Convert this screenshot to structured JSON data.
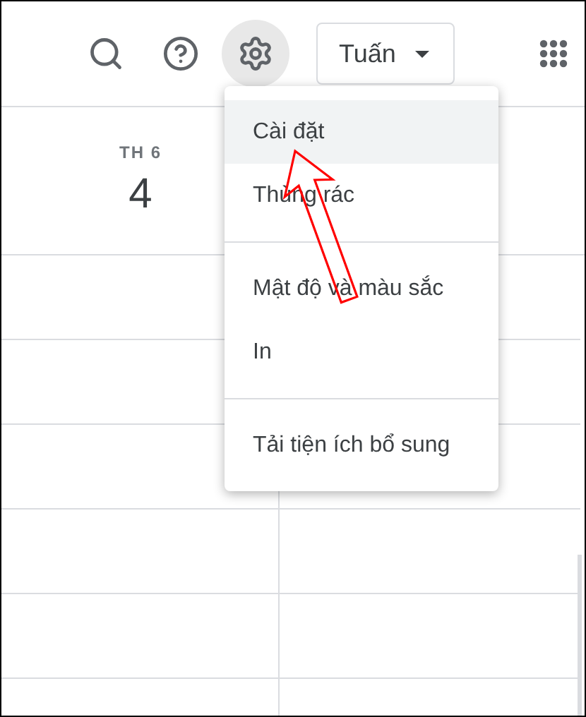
{
  "toolbar": [
    {
      "kind": "search",
      "selected": false
    },
    {
      "kind": "help",
      "selected": false
    },
    {
      "kind": "settings",
      "selected": true
    }
  ],
  "view_button": {
    "label": "Tuấn"
  },
  "day": {
    "weekday": "TH 6",
    "date": "4"
  },
  "menu": {
    "groups": [
      [
        {
          "label": "Cài đặt",
          "selected": true
        },
        {
          "label": "Thùng rác",
          "selected": false
        }
      ],
      [
        {
          "label": "Mật độ và màu sắc",
          "selected": false
        },
        {
          "label": "In",
          "selected": false
        }
      ],
      [
        {
          "label": "Tải tiện ích bổ sung",
          "selected": false
        }
      ]
    ]
  }
}
